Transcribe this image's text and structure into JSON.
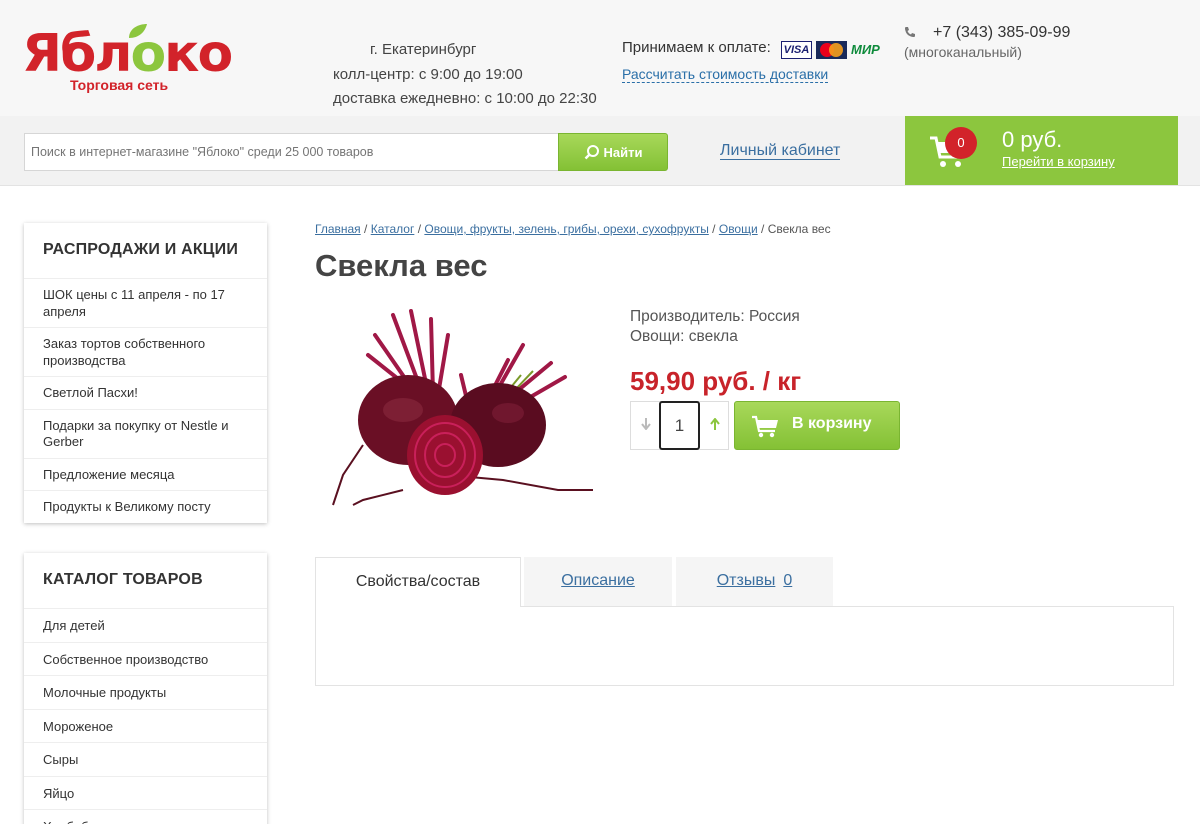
{
  "header": {
    "logo_word": "Ябл",
    "logo_o": "о",
    "logo_tail": "ко",
    "logo_sub": "Торговая сеть",
    "city": "г. Екатеринбург",
    "callcenter": "колл-центр: с 9:00 до 19:00",
    "delivery_hours": "доставка ежедневно: с 10:00 до 22:30",
    "payment_label": "Принимаем к оплате:",
    "cards": [
      "VISA",
      "MasterCard",
      "МИР"
    ],
    "delivery_calc_link": "Рассчитать стоимость доставки",
    "phone": "+7 (343) 385-09-99",
    "phone_note": "(многоканальный)"
  },
  "search": {
    "placeholder": "Поиск в интернет-магазине \"Яблоко\" среди 25 000 товаров",
    "button_label": "Найти"
  },
  "account_link": "Личный кабинет",
  "cart": {
    "count": "0",
    "sum": "0 руб.",
    "link": "Перейти в корзину"
  },
  "sidebar": {
    "promo_title": "РАСПРОДАЖИ И АКЦИИ",
    "promo_items": [
      "ШОК цены с 11 апреля - по 17 апреля",
      "Заказ тортов собственного производства",
      "Светлой Пасхи!",
      "Подарки за покупку от Nestle и Gerber",
      "Предложение месяца",
      "Продукты к Великому посту"
    ],
    "catalog_title": "КАТАЛОГ ТОВАРОВ",
    "catalog_items": [
      "Для детей",
      "Собственное производство",
      "Молочные продукты",
      "Мороженое",
      "Сыры",
      "Яйцо",
      "Хлебобулочные изделия и"
    ]
  },
  "breadcrumbs": {
    "items": [
      "Главная",
      "Каталог",
      "Овощи, фрукты, зелень, грибы, орехи, сухофрукты",
      "Овощи"
    ],
    "separator": "/",
    "current": "Свекла вес"
  },
  "product": {
    "title": "Свекла вес",
    "manufacturer": "Производитель: Россия",
    "vegetable": "Овощи: свекла",
    "price": "59,90 руб. / кг",
    "quantity": "1",
    "add_to_cart": "В корзину"
  },
  "tabs": [
    {
      "label": "Свойства/состав"
    },
    {
      "label": "Описание"
    },
    {
      "label": "Отзывы",
      "count": "0"
    }
  ],
  "colors": {
    "brand_red": "#d2232a",
    "brand_green": "#8cc63e",
    "link_blue": "#3b6fa0",
    "price_red": "#c8232a"
  }
}
